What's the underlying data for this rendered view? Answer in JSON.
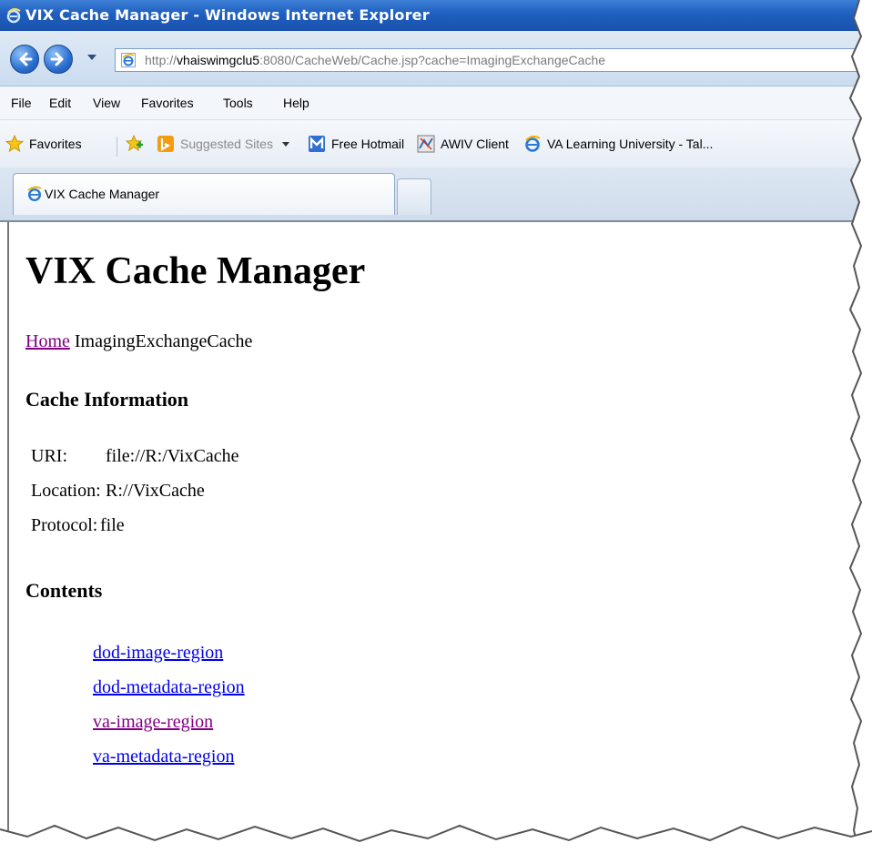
{
  "window": {
    "title": "VIX Cache Manager - Windows Internet Explorer"
  },
  "address_bar": {
    "url_prefix": "http://",
    "url_host": "vhaiswimgclu5",
    "url_rest": ":8080/CacheWeb/Cache.jsp?cache=ImagingExchangeCache"
  },
  "menu": {
    "items": [
      {
        "label": "File",
        "icon": ""
      },
      {
        "label": "Edit",
        "icon": ""
      },
      {
        "label": "View",
        "icon": ""
      },
      {
        "label": "Favorites",
        "icon": ""
      },
      {
        "label": "Tools",
        "icon": ""
      },
      {
        "label": "Help",
        "icon": ""
      }
    ]
  },
  "favorites_bar": {
    "favorites_label": "Favorites",
    "favorites_icon": "star-icon",
    "add_icon": "add-favorites-icon",
    "items": [
      {
        "label": "Suggested Sites",
        "icon": "bing-icon",
        "has_dropdown": true
      },
      {
        "label": "Free Hotmail",
        "icon": "msn-icon"
      },
      {
        "label": "AWIV Client",
        "icon": "awiv-icon"
      },
      {
        "label": "VA Learning University - Tal...",
        "icon": "ie-icon"
      }
    ]
  },
  "tabs": {
    "active_label": "VIX Cache Manager"
  },
  "page": {
    "title": "VIX Cache Manager",
    "breadcrumb": {
      "home_link": "Home",
      "current": "ImagingExchangeCache"
    },
    "cache_info_heading": "Cache Information",
    "cache_info": [
      {
        "key": "URI:",
        "value": "file://R:/VixCache"
      },
      {
        "key": "Location:",
        "value": "R://VixCache"
      },
      {
        "key": "Protocol:",
        "value": "file"
      }
    ],
    "contents_heading": "Contents",
    "contents": [
      {
        "label": "dod-image-region",
        "visited": false
      },
      {
        "label": "dod-metadata-region",
        "visited": false
      },
      {
        "label": "va-image-region",
        "visited": true
      },
      {
        "label": "va-metadata-region",
        "visited": false
      }
    ]
  },
  "colors": {
    "titlebar": "#1f5fbf",
    "link_unvisited": "#0000ee",
    "link_visited": "#800080"
  }
}
